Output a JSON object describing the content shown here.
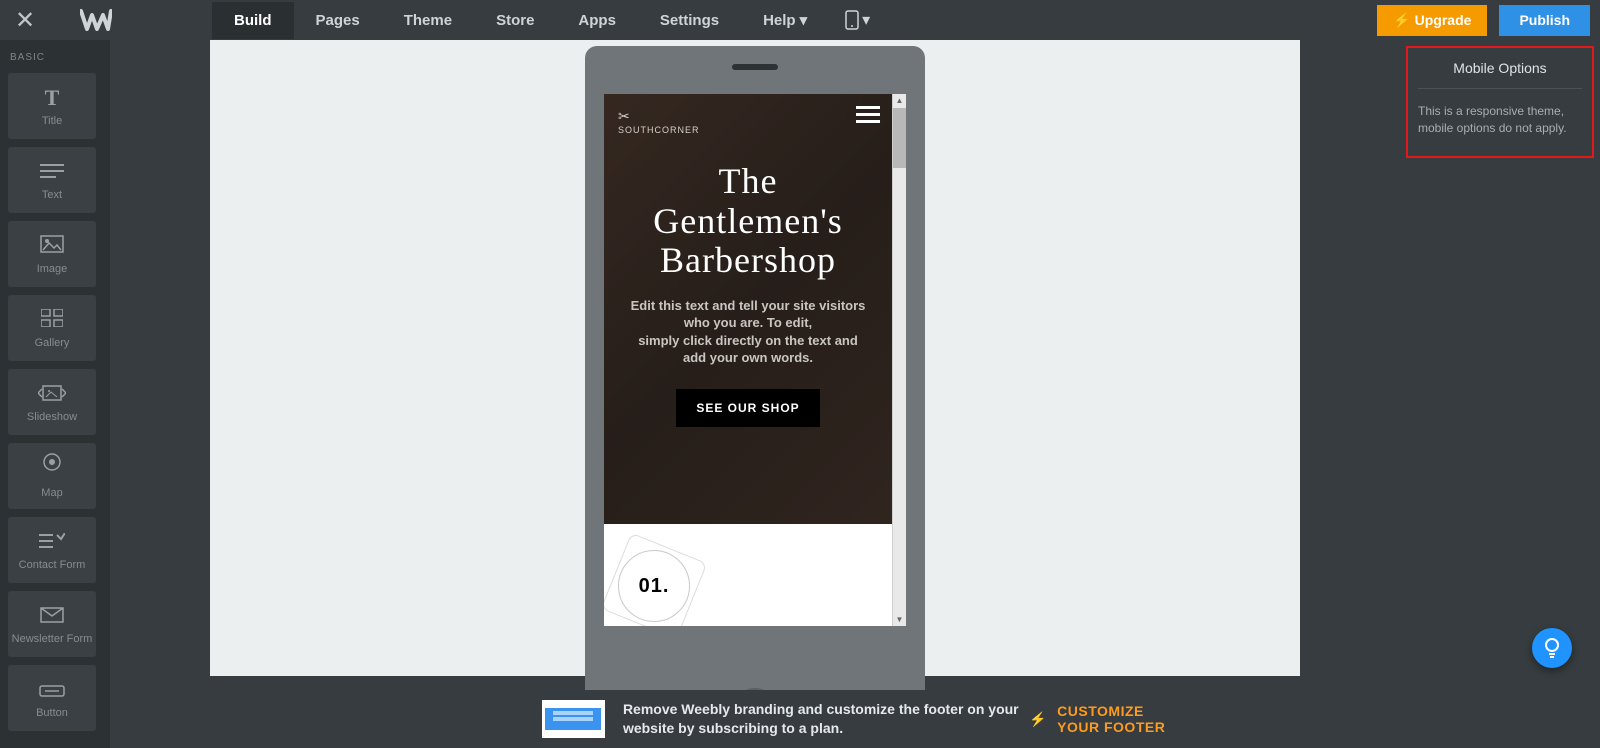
{
  "topbar": {
    "nav": [
      "Build",
      "Pages",
      "Theme",
      "Store",
      "Apps",
      "Settings",
      "Help"
    ],
    "active": "Build",
    "upgrade": "Upgrade",
    "publish": "Publish"
  },
  "sidebar": {
    "section": "BASIC",
    "items": [
      {
        "label": "Title",
        "icon": "T"
      },
      {
        "label": "Text",
        "icon": "≡"
      },
      {
        "label": "Image",
        "icon": "▧"
      },
      {
        "label": "Gallery",
        "icon": "▦"
      },
      {
        "label": "Slideshow",
        "icon": "⧉"
      },
      {
        "label": "Map",
        "icon": "◎"
      },
      {
        "label": "Contact Form",
        "icon": "☲"
      },
      {
        "label": "Newsletter Form",
        "icon": "✉"
      },
      {
        "label": "Button",
        "icon": "▭"
      }
    ]
  },
  "preview": {
    "brandTop": "✂",
    "brand": "SOUTHCORNER",
    "title": "The Gentlemen's Barbershop",
    "sub1": "Edit this text and tell your site visitors who you are. To edit,",
    "sub2": "simply click directly on the text and add your own words.",
    "cta": "SEE OUR SHOP",
    "num": "01."
  },
  "rightPanel": {
    "title": "Mobile Options",
    "text": "This is a responsive theme, mobile options do not apply."
  },
  "footer": {
    "text": "Remove Weebly branding and customize the footer on your website by subscribing to a plan.",
    "cta": "CUSTOMIZE YOUR FOOTER"
  }
}
